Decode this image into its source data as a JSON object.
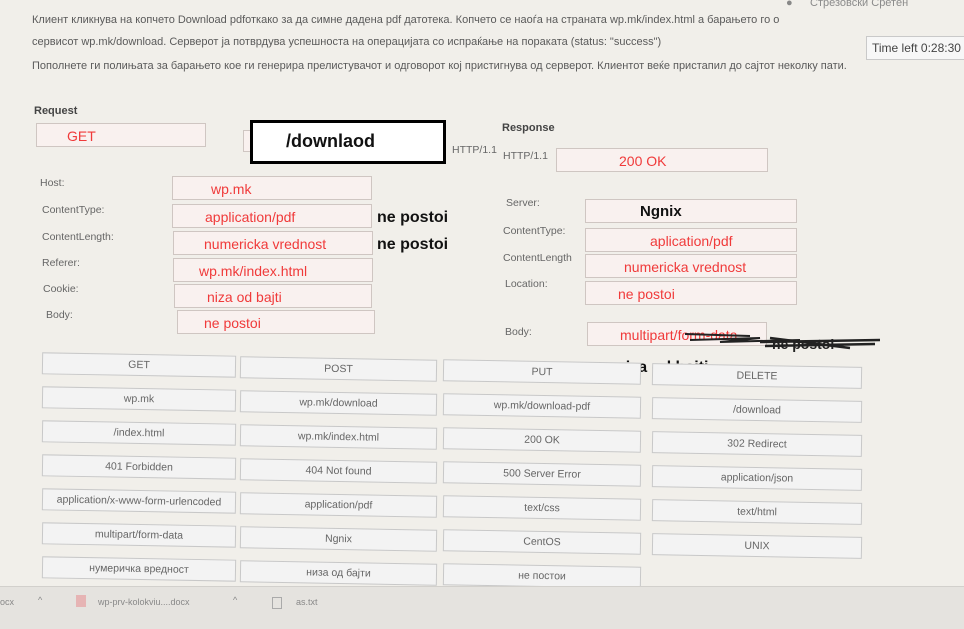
{
  "header": {
    "user_name": "Стрезовски Сретен",
    "instructions": [
      "Клиент кликнува на копчето Download pdfоткако за да симне дадена pdf датотека. Копчето се наоѓа на страната wp.mk/index.html а барањето го о",
      "сервисот wp.mk/download. Серверот ја потврдува успешноста на операцијата со испраќање на пораката (status: \"success\")",
      "Пополнете ги полињата за барањето кое ги генерира прелистувачот и одговорот кој пристигнува од серверот. Клиентот веќе пристапил до сајтот неколку пати."
    ],
    "timer": "Time left 0:28:30"
  },
  "request": {
    "title": "Request",
    "method": "GET",
    "url": "/downlaod",
    "protocol": "HTTP/1.1",
    "fields": [
      {
        "label": "Host:",
        "value": "wp.mk",
        "note": ""
      },
      {
        "label": "ContentType:",
        "value": "application/pdf",
        "note": "ne postoi"
      },
      {
        "label": "ContentLength:",
        "value": "numericka vrednost",
        "note": "ne postoi"
      },
      {
        "label": "Referer:",
        "value": "wp.mk/index.html",
        "note": ""
      },
      {
        "label": "Cookie:",
        "value": "niza od bajti",
        "note": ""
      },
      {
        "label": "Body:",
        "value": "ne postoi",
        "note": ""
      }
    ]
  },
  "response": {
    "title": "Response",
    "protocol": "HTTP/1.1",
    "status": "200 OK",
    "fields": [
      {
        "label": "Server:",
        "value": "Ngnix",
        "note": ""
      },
      {
        "label": "ContentType:",
        "value": "aplication/pdf",
        "note": ""
      },
      {
        "label": "ContentLength",
        "value": "numericka vrednost",
        "note": ""
      },
      {
        "label": "Location:",
        "value": "ne postoi",
        "note": ""
      },
      {
        "label": "Body:",
        "value": "multipart/form-data",
        "note": "niza od bajti"
      }
    ],
    "scribble_text": "ne postoi"
  },
  "options": [
    [
      "GET",
      "POST",
      "PUT",
      "DELETE"
    ],
    [
      "wp.mk",
      "wp.mk/download",
      "wp.mk/download-pdf",
      "/download"
    ],
    [
      "/index.html",
      "wp.mk/index.html",
      "200 OK",
      "302 Redirect"
    ],
    [
      "401 Forbidden",
      "404 Not found",
      "500 Server Error",
      "application/json"
    ],
    [
      "application/x-www-form-urlencoded",
      "application/pdf",
      "text/css",
      "text/html"
    ],
    [
      "multipart/form-data",
      "Ngnix",
      "CentOS",
      "UNIX"
    ],
    [
      "нумеричка вредност",
      "низа од бајти",
      "не постои",
      ""
    ]
  ],
  "taskbar": {
    "left_text": "ocx",
    "file1": "wp-prv-kolokviu....docx",
    "file2": "as.txt"
  },
  "colors": {
    "answer_red": "#f03a3a",
    "field_bg": "#f9f1ef",
    "note_black": "#111111"
  }
}
